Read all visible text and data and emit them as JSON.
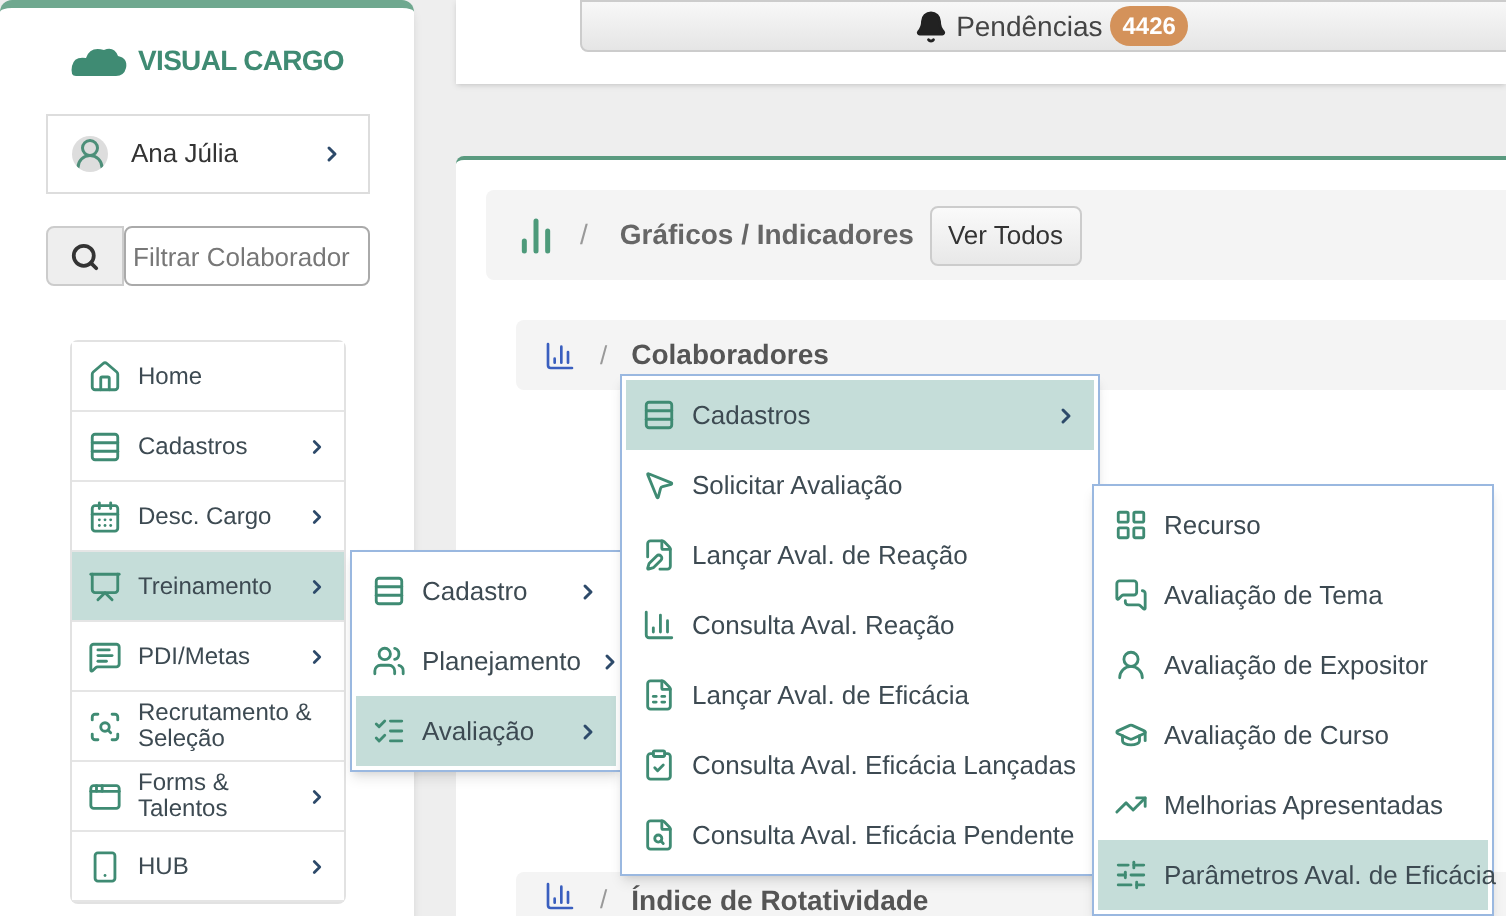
{
  "logo": {
    "text": "VISUAL CARGO"
  },
  "user": {
    "name": "Ana Júlia"
  },
  "search": {
    "placeholder": "Filtrar Colaborador"
  },
  "sidebar": {
    "items": [
      {
        "label": "Home",
        "selected": false,
        "has_submenu": false
      },
      {
        "label": "Cadastros",
        "selected": false,
        "has_submenu": true
      },
      {
        "label": "Desc. Cargo",
        "selected": false,
        "has_submenu": true
      },
      {
        "label": "Treinamento",
        "selected": true,
        "has_submenu": true
      },
      {
        "label": "PDI/Metas",
        "selected": false,
        "has_submenu": true
      },
      {
        "label": "Recrutamento & Seleção",
        "selected": false,
        "has_submenu": false
      },
      {
        "label": "Forms & Talentos",
        "selected": false,
        "has_submenu": true
      },
      {
        "label": "HUB",
        "selected": false,
        "has_submenu": true
      }
    ]
  },
  "pendencias": {
    "label": "Pendências",
    "count": "4426"
  },
  "dashboard": {
    "separator": "/",
    "title": "Gráficos / Indicadores",
    "button": "Ver Todos",
    "sections": [
      {
        "separator": "/",
        "title": "Colaboradores"
      },
      {
        "separator": "/",
        "title": "Índice de Rotatividade"
      }
    ]
  },
  "menu_1": {
    "items": [
      {
        "label": "Cadastro",
        "selected": false,
        "has_submenu": true
      },
      {
        "label": "Planejamento",
        "selected": false,
        "has_submenu": true
      },
      {
        "label": "Avaliação",
        "selected": true,
        "has_submenu": true
      }
    ]
  },
  "menu_2": {
    "items": [
      {
        "label": "Cadastros",
        "selected": true,
        "has_submenu": true
      },
      {
        "label": "Solicitar Avaliação",
        "selected": false,
        "has_submenu": false
      },
      {
        "label": "Lançar Aval. de Reação",
        "selected": false,
        "has_submenu": false
      },
      {
        "label": "Consulta Aval. Reação",
        "selected": false,
        "has_submenu": false
      },
      {
        "label": "Lançar Aval. de Eficácia",
        "selected": false,
        "has_submenu": false
      },
      {
        "label": "Consulta Aval. Eficácia Lançadas",
        "selected": false,
        "has_submenu": false
      },
      {
        "label": "Consulta Aval. Eficácia Pendente",
        "selected": false,
        "has_submenu": false
      }
    ]
  },
  "menu_3": {
    "items": [
      {
        "label": "Recurso",
        "selected": false
      },
      {
        "label": "Avaliação de Tema",
        "selected": false
      },
      {
        "label": "Avaliação de Expositor",
        "selected": false
      },
      {
        "label": "Avaliação de Curso",
        "selected": false
      },
      {
        "label": "Melhorias Apresentadas",
        "selected": false
      },
      {
        "label": "Parâmetros Aval. de Eficácia",
        "selected": true
      }
    ]
  }
}
